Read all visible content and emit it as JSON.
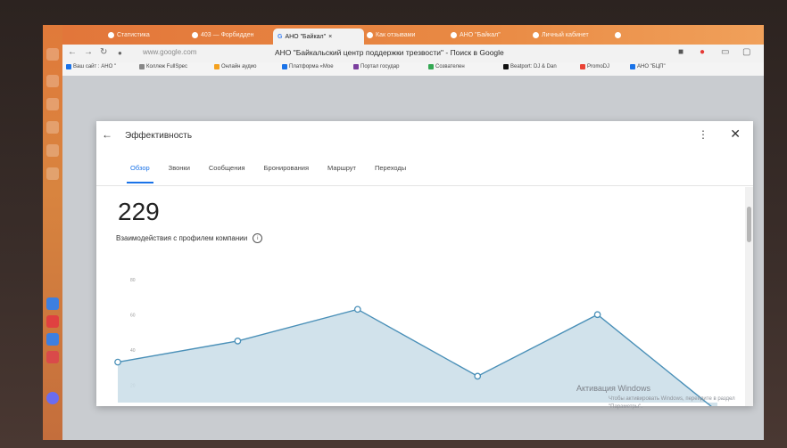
{
  "browser": {
    "tabs": [
      {
        "label": "Статистика",
        "active": false
      },
      {
        "label": "403 — Форбидден",
        "active": false
      },
      {
        "label": "АНО \"Байкал\"",
        "active": true
      },
      {
        "label": "Как отзывами",
        "active": false
      },
      {
        "label": "АНО \"Байкал\"",
        "active": false
      },
      {
        "label": "Личный кабинет",
        "active": false
      }
    ],
    "url": "www.google.com",
    "page_title": "АНО \"Байкальский центр поддержки трезвости\" - Поиск в Google",
    "bookmarks": [
      {
        "label": "Ваш сайт : АНО \"",
        "color": "#1a73e8"
      },
      {
        "label": "Коллеж FullSpec",
        "color": "#888888"
      },
      {
        "label": "Онлайн аудио",
        "color": "#f4a11f"
      },
      {
        "label": "Платформа «Мое",
        "color": "#1a73e8"
      },
      {
        "label": "Портал государ",
        "color": "#7b3f9e"
      },
      {
        "label": "Созвателен",
        "color": "#34a853"
      },
      {
        "label": "Beatport: DJ & Dan",
        "color": "#111111"
      },
      {
        "label": "PromoDJ",
        "color": "#ea4335"
      },
      {
        "label": "АНО \"БЦП\"",
        "color": "#1a73e8"
      }
    ]
  },
  "dialog": {
    "title": "Эффективность",
    "tabs": [
      {
        "label": "Обзор",
        "active": true
      },
      {
        "label": "Звонки",
        "active": false
      },
      {
        "label": "Сообщения",
        "active": false
      },
      {
        "label": "Бронирования",
        "active": false
      },
      {
        "label": "Маршрут",
        "active": false
      },
      {
        "label": "Переходы",
        "active": false
      }
    ],
    "big_number": "229",
    "metric_label": "Взаимодействия с профилем компании"
  },
  "chart_data": {
    "type": "area",
    "yticks": [
      20,
      40,
      60,
      80
    ],
    "ylim": [
      10,
      90
    ],
    "x": [
      0,
      1,
      2,
      3,
      4,
      5
    ],
    "values": [
      33,
      45,
      63,
      25,
      60,
      5
    ],
    "color": "#4a90b8",
    "fill": "#c9dde8",
    "grid": false
  },
  "windows_watermark": {
    "line1": "Активация Windows",
    "line2": "Чтобы активировать Windows, перейдите в раздел \"Параметры\"."
  },
  "colors": {
    "opera_orange": "#e2763a",
    "accent_blue": "#1a73e8"
  }
}
